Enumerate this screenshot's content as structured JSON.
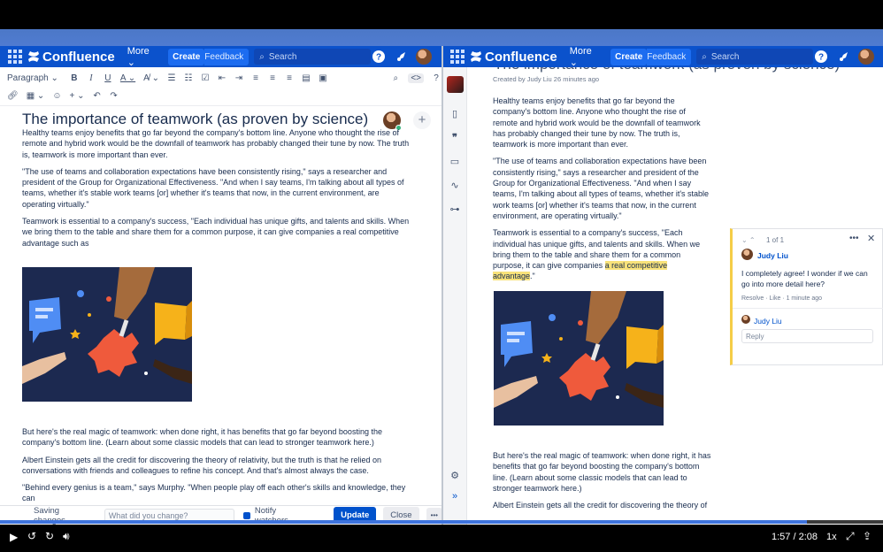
{
  "app": {
    "name": "Confluence",
    "more": "More",
    "create": "Create",
    "feedback": "Feedback",
    "search_placeholder": "Search"
  },
  "editor": {
    "paragraph_style": "Paragraph",
    "title": "The importance of teamwork (as proven by science)",
    "paragraphs": [
      "Healthy teams enjoy benefits that go far beyond the company's bottom line. Anyone who thought the rise of remote and hybrid work would be the downfall of teamwork has probably changed their tune by now. The truth is, teamwork is more important than ever.",
      "\"The use of teams and collaboration expectations have been consistently rising,\" says a researcher and president of the Group for Organizational Effectiveness. \"And when I say teams, I'm talking about all types of teams, whether it's stable work teams [or] whether it's teams that now, in the current environment, are operating virtually.\"",
      "Teamwork is essential to a company's success, \"Each individual has unique gifts, and talents and skills. When we bring them to the table and share them for a common purpose, it can give companies a real competitive advantage such as"
    ],
    "paragraphs_after": [
      "But here's the real magic of teamwork: when done right, it has benefits that go far beyond boosting the company's bottom line. (Learn about some classic models that can lead to stronger teamwork here.)",
      "Albert Einstein gets all the credit for discovering the theory of relativity, but the truth is that he relied on conversations with friends and colleagues to refine his concept. And that's almost always the case.",
      "\"Behind every genius is a team,\" says Murphy. \"When people play off each other's skills and knowledge, they can"
    ],
    "status": "Saving changes",
    "change_placeholder": "What did you change?",
    "notify": "Notify watchers",
    "update": "Update",
    "close": "Close",
    "more": "•••"
  },
  "viewer": {
    "title": "The importance of teamwork (as proven by science)",
    "byline": "Created by Judy Liu 26 minutes ago",
    "p1": "Healthy teams enjoy benefits that go far beyond the company's bottom line. Anyone who thought the rise of remote and hybrid work would be the downfall of teamwork has probably changed their tune by now. The truth is, teamwork is more important than ever.",
    "p2": "\"The use of teams and collaboration expectations have been consistently rising,\" says a researcher and president of the Group for Organizational Effectiveness. \"And when I say teams, I'm talking about all types of teams, whether it's stable work teams [or] whether it's teams that now, in the current environment, are operating virtually.\"",
    "p3_before": "Teamwork is essential to a company's success, \"Each individual has unique gifts, and talents and skills. When we bring them to the table and share them for a common purpose, it can give companies ",
    "p3_highlight": "a real competitive advantage",
    "p3_after": ".\"",
    "p4": "But here's the real magic of teamwork: when done right, it has benefits that go far beyond boosting the company's bottom line. (Learn about some classic models that can lead to stronger teamwork here.)",
    "p5": "Albert Einstein gets all the credit for discovering the theory of"
  },
  "comment": {
    "counter": "1 of 1",
    "author": "Judy Liu",
    "text": "I completely agree! I wonder if we can go into more detail here?",
    "meta": "Resolve · Like · 1 minute ago",
    "reply_author": "Judy Liu",
    "reply_placeholder": "Reply"
  },
  "player": {
    "time": "1:57 / 2:08",
    "speed": "1x",
    "progress": 0.914
  },
  "colors": {
    "nav": "#0b52cc",
    "accent": "#0052cc",
    "highlight": "#f8e27a"
  }
}
